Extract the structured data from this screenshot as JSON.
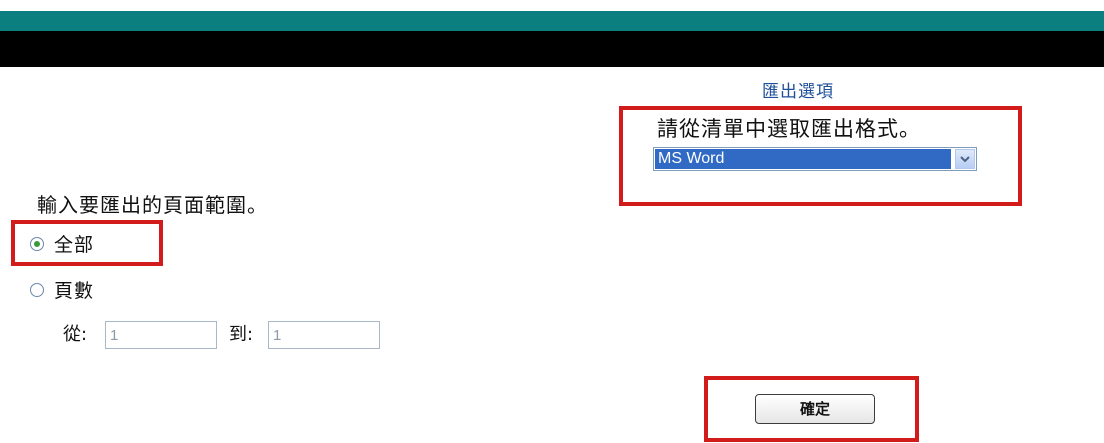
{
  "header": {
    "teal_color": "#0b7f80",
    "black_color": "#000000"
  },
  "export_options": {
    "title": "匯出選項",
    "format_instruction": "請從清單中選取匯出格式。",
    "format_selected": "MS Word"
  },
  "page_range": {
    "instruction": "輸入要匯出的頁面範圍。",
    "all_label": "全部",
    "pages_label": "頁數",
    "all_selected": true,
    "from_label": "從:",
    "from_value": "1",
    "to_label": "到:",
    "to_value": "1"
  },
  "ok_button": {
    "label": "確定"
  },
  "highlight_color": "#d21b1b"
}
